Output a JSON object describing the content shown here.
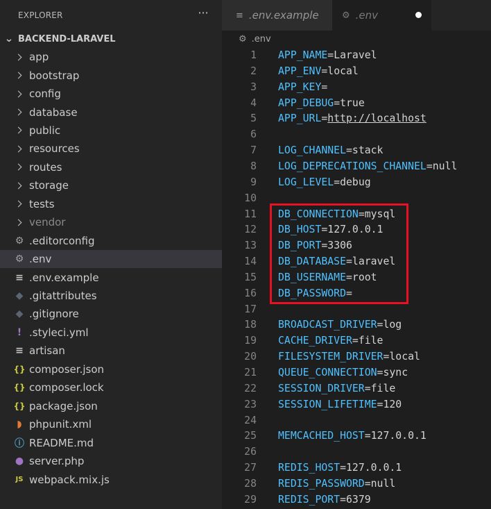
{
  "explorer": {
    "title": "EXPLORER",
    "more_label": "···",
    "section_title": "BACKEND-LARAVEL",
    "items": [
      {
        "label": "app",
        "type": "folder"
      },
      {
        "label": "bootstrap",
        "type": "folder"
      },
      {
        "label": "config",
        "type": "folder"
      },
      {
        "label": "database",
        "type": "folder"
      },
      {
        "label": "public",
        "type": "folder"
      },
      {
        "label": "resources",
        "type": "folder"
      },
      {
        "label": "routes",
        "type": "folder"
      },
      {
        "label": "storage",
        "type": "folder"
      },
      {
        "label": "tests",
        "type": "folder"
      },
      {
        "label": "vendor",
        "type": "folder",
        "dimmed": true
      },
      {
        "label": ".editorconfig",
        "type": "file",
        "icon": "gear-icon",
        "glyph": "⚙",
        "color": "#a0a0a0"
      },
      {
        "label": ".env",
        "type": "file",
        "icon": "gear-icon",
        "glyph": "⚙",
        "color": "#a0a0a0",
        "selected": true
      },
      {
        "label": ".env.example",
        "type": "file",
        "icon": "lines-icon",
        "glyph": "≡",
        "color": "#c5c5c5"
      },
      {
        "label": ".gitattributes",
        "type": "file",
        "icon": "git-icon",
        "glyph": "◆",
        "color": "#5a6571"
      },
      {
        "label": ".gitignore",
        "type": "file",
        "icon": "git-icon",
        "glyph": "◆",
        "color": "#5a6571"
      },
      {
        "label": ".styleci.yml",
        "type": "file",
        "icon": "exclamation-icon",
        "glyph": "!",
        "color": "#a074c4"
      },
      {
        "label": "artisan",
        "type": "file",
        "icon": "lines-icon",
        "glyph": "≡",
        "color": "#c5c5c5"
      },
      {
        "label": "composer.json",
        "type": "file",
        "icon": "braces-icon",
        "glyph": "{}",
        "color": "#cbcb41"
      },
      {
        "label": "composer.lock",
        "type": "file",
        "icon": "braces-icon",
        "glyph": "{}",
        "color": "#cbcb41"
      },
      {
        "label": "package.json",
        "type": "file",
        "icon": "braces-icon",
        "glyph": "{}",
        "color": "#cbcb41"
      },
      {
        "label": "phpunit.xml",
        "type": "file",
        "icon": "rss-icon",
        "glyph": "◗",
        "color": "#e37933"
      },
      {
        "label": "README.md",
        "type": "file",
        "icon": "info-icon",
        "glyph": "ⓘ",
        "color": "#519aba"
      },
      {
        "label": "server.php",
        "type": "file",
        "icon": "elephant-icon",
        "glyph": "●",
        "color": "#a074c4"
      },
      {
        "label": "webpack.mix.js",
        "type": "file",
        "icon": "js-icon",
        "glyph": "JS",
        "color": "#cbcb41"
      }
    ]
  },
  "tabs": [
    {
      "label": ".env.example",
      "icon": "lines-icon",
      "glyph": "≡",
      "active": false
    },
    {
      "label": ".env",
      "icon": "gear-icon",
      "glyph": "⚙",
      "active": true,
      "dirty": true
    }
  ],
  "breadcrumb": {
    "label": ".env",
    "icon": "gear-icon",
    "glyph": "⚙"
  },
  "colors": {
    "key": "#4fc1ff",
    "value": "#d4d4d4",
    "highlight_border": "#e81123"
  },
  "code_lines": [
    {
      "n": "1",
      "key": "APP_NAME",
      "val": "Laravel"
    },
    {
      "n": "2",
      "key": "APP_ENV",
      "val": "local"
    },
    {
      "n": "3",
      "key": "APP_KEY",
      "val": ""
    },
    {
      "n": "4",
      "key": "APP_DEBUG",
      "val": "true"
    },
    {
      "n": "5",
      "key": "APP_URL",
      "val": "http://localhost",
      "link": true
    },
    {
      "n": "6",
      "key": "",
      "val": ""
    },
    {
      "n": "7",
      "key": "LOG_CHANNEL",
      "val": "stack"
    },
    {
      "n": "8",
      "key": "LOG_DEPRECATIONS_CHANNEL",
      "val": "null"
    },
    {
      "n": "9",
      "key": "LOG_LEVEL",
      "val": "debug"
    },
    {
      "n": "10",
      "key": "",
      "val": ""
    },
    {
      "n": "11",
      "key": "DB_CONNECTION",
      "val": "mysql"
    },
    {
      "n": "12",
      "key": "DB_HOST",
      "val": "127.0.0.1"
    },
    {
      "n": "13",
      "key": "DB_PORT",
      "val": "3306"
    },
    {
      "n": "14",
      "key": "DB_DATABASE",
      "val": "laravel"
    },
    {
      "n": "15",
      "key": "DB_USERNAME",
      "val": "root"
    },
    {
      "n": "16",
      "key": "DB_PASSWORD",
      "val": ""
    },
    {
      "n": "17",
      "key": "",
      "val": ""
    },
    {
      "n": "18",
      "key": "BROADCAST_DRIVER",
      "val": "log"
    },
    {
      "n": "19",
      "key": "CACHE_DRIVER",
      "val": "file"
    },
    {
      "n": "20",
      "key": "FILESYSTEM_DRIVER",
      "val": "local"
    },
    {
      "n": "21",
      "key": "QUEUE_CONNECTION",
      "val": "sync"
    },
    {
      "n": "22",
      "key": "SESSION_DRIVER",
      "val": "file"
    },
    {
      "n": "23",
      "key": "SESSION_LIFETIME",
      "val": "120"
    },
    {
      "n": "24",
      "key": "",
      "val": ""
    },
    {
      "n": "25",
      "key": "MEMCACHED_HOST",
      "val": "127.0.0.1"
    },
    {
      "n": "26",
      "key": "",
      "val": ""
    },
    {
      "n": "27",
      "key": "REDIS_HOST",
      "val": "127.0.0.1"
    },
    {
      "n": "28",
      "key": "REDIS_PASSWORD",
      "val": "null"
    },
    {
      "n": "29",
      "key": "REDIS_PORT",
      "val": "6379"
    }
  ]
}
